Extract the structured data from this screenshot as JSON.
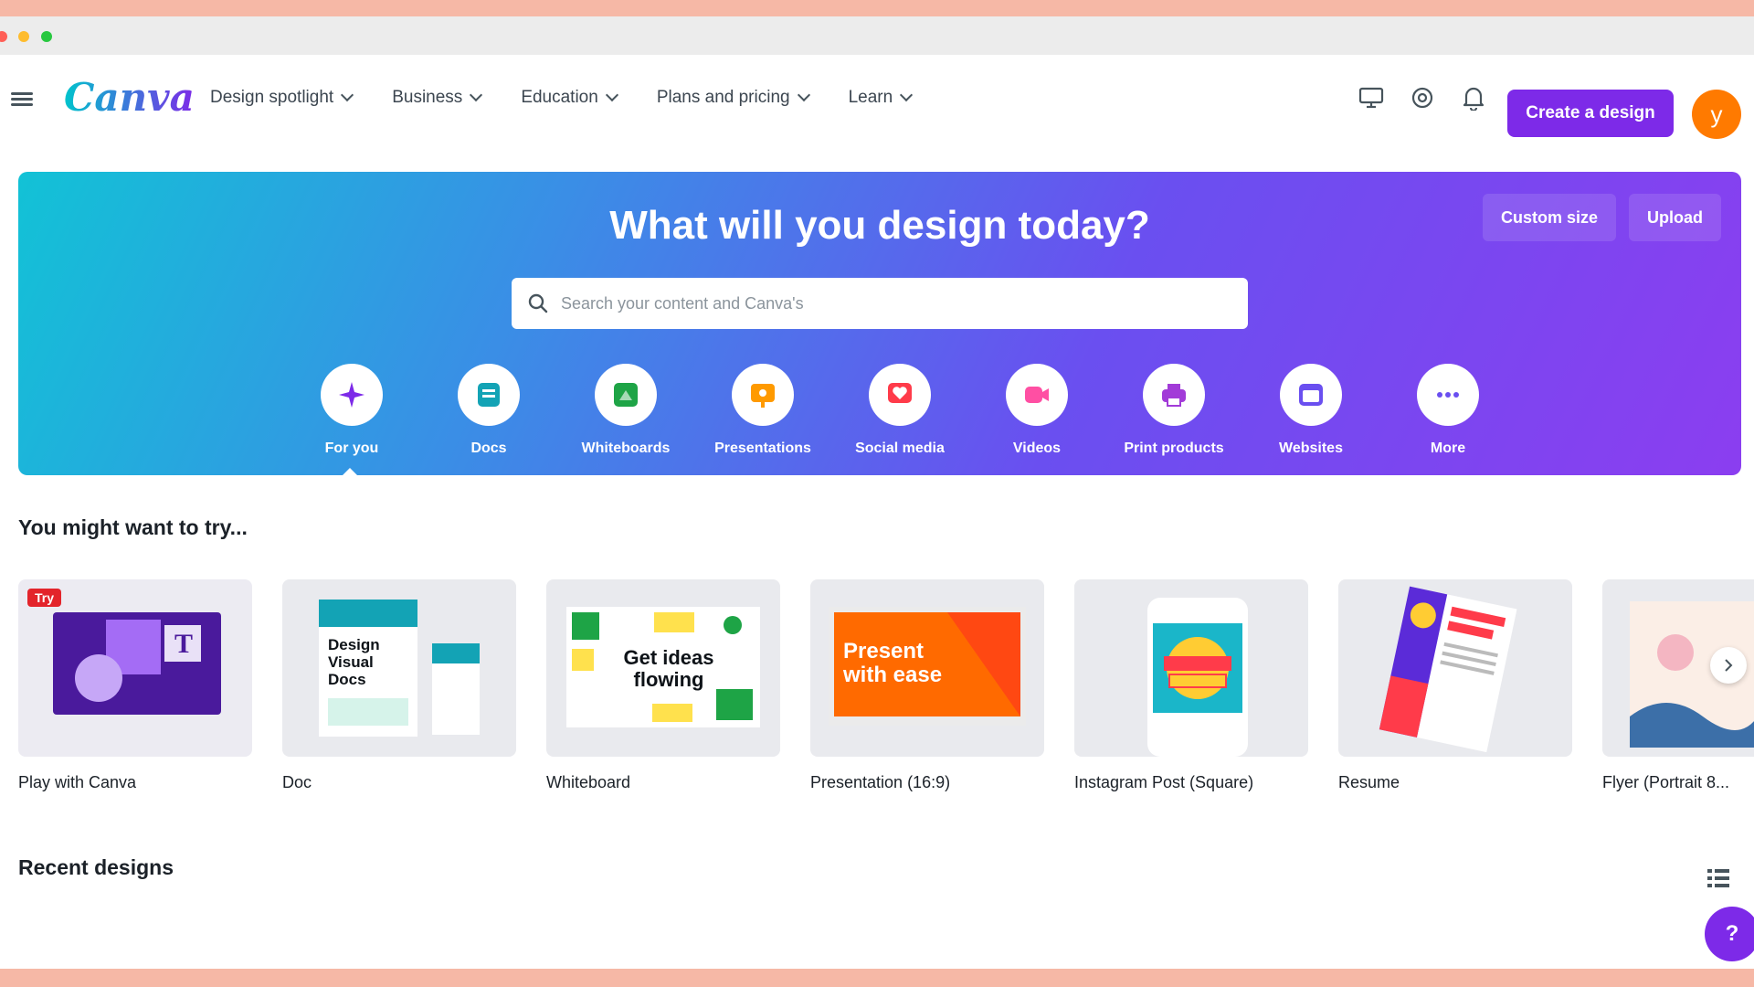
{
  "colors": {
    "brand": "#7d2ae8",
    "teal": "#00c4cc",
    "avatar": "#ff7a00",
    "badge": "#e3242b"
  },
  "nav": {
    "logo": "Canva",
    "menu": [
      {
        "label": "Design spotlight",
        "icon": "chevron-down-icon"
      },
      {
        "label": "Business",
        "icon": "chevron-down-icon"
      },
      {
        "label": "Education",
        "icon": "chevron-down-icon"
      },
      {
        "label": "Plans and pricing",
        "icon": "chevron-down-icon"
      },
      {
        "label": "Learn",
        "icon": "chevron-down-icon"
      }
    ],
    "icons": [
      "monitor-icon",
      "settings-icon",
      "bell-icon"
    ],
    "create_label": "Create a design",
    "avatar_initial": "y"
  },
  "hero": {
    "title": "What will you design today?",
    "custom_size": "Custom size",
    "upload": "Upload",
    "search_placeholder": "Search your content and Canva's",
    "categories": [
      {
        "label": "For you",
        "icon": "sparkle-icon",
        "color": "#7d2ae8",
        "selected": true
      },
      {
        "label": "Docs",
        "icon": "doc-icon",
        "color": "#13a3b5"
      },
      {
        "label": "Whiteboards",
        "icon": "whiteboard-icon",
        "color": "#1ea446"
      },
      {
        "label": "Presentations",
        "icon": "presentation-icon",
        "color": "#ff9a00"
      },
      {
        "label": "Social media",
        "icon": "heart-icon",
        "color": "#ff3b4a"
      },
      {
        "label": "Videos",
        "icon": "video-icon",
        "color": "#ff4fa3"
      },
      {
        "label": "Print products",
        "icon": "printer-icon",
        "color": "#a23bd8"
      },
      {
        "label": "Websites",
        "icon": "website-icon",
        "color": "#6a4ff0"
      },
      {
        "label": "More",
        "icon": "more-icon",
        "color": "#6a4ff0"
      }
    ]
  },
  "try_section": {
    "title": "You might want to try...",
    "badge": "Try",
    "cards": [
      {
        "label": "Play with Canva"
      },
      {
        "label": "Doc",
        "thumb_text": "Design Visual Docs"
      },
      {
        "label": "Whiteboard",
        "thumb_text": "Get ideas flowing"
      },
      {
        "label": "Presentation (16:9)",
        "thumb_text": "Present with ease"
      },
      {
        "label": "Instagram Post (Square)"
      },
      {
        "label": "Resume"
      },
      {
        "label": "Flyer (Portrait 8..."
      }
    ]
  },
  "recent": {
    "title": "Recent designs"
  },
  "help_label": "?"
}
